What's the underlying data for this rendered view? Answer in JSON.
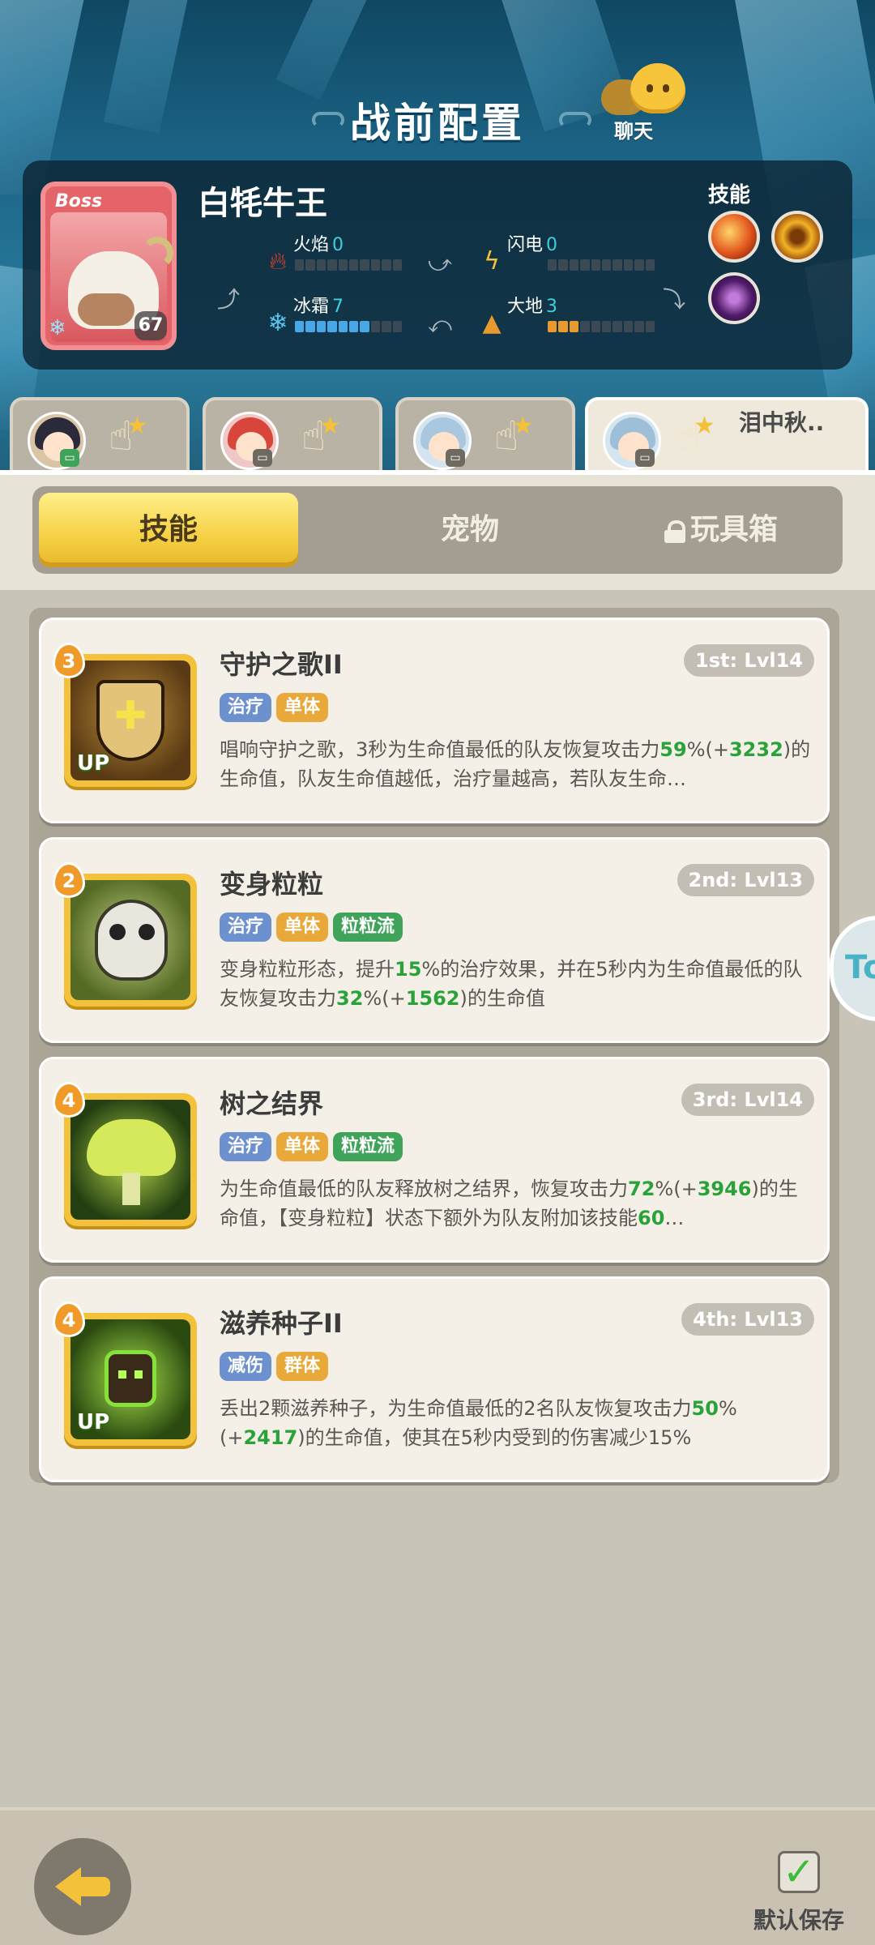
{
  "header": {
    "title": "战前配置",
    "chat_label": "聊天"
  },
  "boss": {
    "tag": "Boss",
    "name": "白牦牛王",
    "level": "67",
    "skills_label": "技能",
    "skill_icons": [
      "fire-skill-icon",
      "gold-ring-skill-icon",
      "dark-skill-icon"
    ],
    "elements": {
      "fire": {
        "label": "火焰",
        "value": "0",
        "level": 0
      },
      "lightning": {
        "label": "闪电",
        "value": "0",
        "level": 0
      },
      "ice": {
        "label": "冰霜",
        "value": "7",
        "level": 7
      },
      "earth": {
        "label": "大地",
        "value": "3",
        "level": 3
      }
    }
  },
  "team": [
    {
      "name": ""
    },
    {
      "name": ""
    },
    {
      "name": ""
    },
    {
      "name": "泪中秋.."
    }
  ],
  "tabs": {
    "skills": "技能",
    "pets": "宠物",
    "toybox": "玩具箱"
  },
  "skills": [
    {
      "cost": "3",
      "name": "守护之歌II",
      "rank": "1st: Lvl14",
      "tags": [
        "治疗",
        "单体"
      ],
      "up": "UP",
      "desc": [
        "唱响守护之歌，3秒为生命值最低的队友恢复攻击力",
        "59",
        "%(+",
        "3232",
        ")的生命值，队友生命值越低，治疗量越高，若队友生命…"
      ]
    },
    {
      "cost": "2",
      "name": "变身粒粒",
      "rank": "2nd: Lvl13",
      "tags": [
        "治疗",
        "单体",
        "粒粒流"
      ],
      "desc": [
        "变身粒粒形态，提升",
        "15",
        "%的治疗效果，并在5秒内为生命值最低的队友恢复攻击力",
        "32",
        "%(+",
        "1562",
        ")的生命值"
      ]
    },
    {
      "cost": "4",
      "name": "树之结界",
      "rank": "3rd: Lvl14",
      "tags": [
        "治疗",
        "单体",
        "粒粒流"
      ],
      "desc": [
        "为生命值最低的队友释放树之结界，恢复攻击力",
        "72",
        "%(+",
        "3946",
        ")的生命值，【变身粒粒】状态下额外为队友附加该技能",
        "60",
        "…"
      ]
    },
    {
      "cost": "4",
      "name": "滋养种子II",
      "rank": "4th: Lvl13",
      "tags": [
        "减伤",
        "群体"
      ],
      "up": "UP",
      "desc": [
        "丢出2颗滋养种子，为生命值最低的2名队友恢复攻击力",
        "50",
        "%(+",
        "2417",
        ")的生命值，使其在5秒内受到的伤害减少15%"
      ]
    }
  ],
  "side_tab_label": "To",
  "footer": {
    "save_label": "默认保存"
  }
}
